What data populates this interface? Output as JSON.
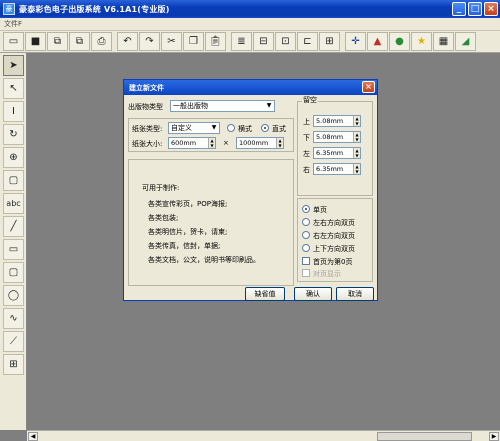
{
  "window": {
    "title": "豪泰彩色电子出版系统 V6.1A1(专业版)"
  },
  "menu": {
    "items": [
      "文件F"
    ]
  },
  "toolbar": {
    "buttons": [
      "new-icon",
      "save-icon",
      "import-icon",
      "export-icon",
      "print-icon",
      "undo-icon",
      "redo-icon",
      "cut-icon",
      "copy-icon",
      "paste-icon",
      "layers-icon",
      "align-icon",
      "group-icon",
      "ungroup-icon",
      "frame-icon",
      "move-cross-icon",
      "color-icon",
      "gradient-icon",
      "star-icon",
      "map-icon",
      "chart-icon"
    ]
  },
  "left_tools": [
    {
      "name": "select-arrow-icon",
      "glyph": "▲"
    },
    {
      "name": "node-arrow-icon",
      "glyph": "↖"
    },
    {
      "name": "text-tool-icon",
      "glyph": "I"
    },
    {
      "name": "rotate-icon",
      "glyph": "↻"
    },
    {
      "name": "zoom-icon",
      "glyph": "⊕"
    },
    {
      "name": "frame-tool-icon",
      "glyph": "▢"
    },
    {
      "name": "abc-text-icon",
      "glyph": "abc"
    },
    {
      "name": "line-tool-icon",
      "glyph": "╱"
    },
    {
      "name": "rectangle-tool-icon",
      "glyph": "▭"
    },
    {
      "name": "rounded-rect-tool-icon",
      "glyph": "▢"
    },
    {
      "name": "ellipse-tool-icon",
      "glyph": "◯"
    },
    {
      "name": "curve-tool-icon",
      "glyph": "∿"
    },
    {
      "name": "polyline-tool-icon",
      "glyph": "⟋"
    },
    {
      "name": "table-tool-icon",
      "glyph": "⊞"
    }
  ],
  "dialog": {
    "title": "建立新文件",
    "pub_type_label": "出版物类型",
    "pub_type_value": "一般出版物",
    "paper_type_label": "纸张类型:",
    "paper_type_value": "自定义",
    "orientation_landscape": "横式",
    "orientation_portrait": "直式",
    "paper_size_label": "纸张大小:",
    "width_value": "600mm",
    "times": "×",
    "height_value": "1000mm",
    "margin_group": "留空",
    "margin_top_label": "上",
    "margin_top": "5.08mm",
    "margin_bottom_label": "下",
    "margin_bottom": "5.08mm",
    "margin_left_label": "左",
    "margin_left": "6.35mm",
    "margin_right_label": "右",
    "margin_right": "6.35mm",
    "usage_title": "可用于制作:",
    "usage_lines": [
      "各类宣传彩页，POP海报;",
      "各类包装;",
      "各类明信片，贺卡，请柬;",
      "各类传真，信封，单据;",
      "各类文档，公文，说明书等印刷品。"
    ],
    "page_opt_single": "单页",
    "page_opt_lr": "左右方向双页",
    "page_opt_rl": "右左方向双页",
    "page_opt_tb": "上下方向双页",
    "first_page_zero": "首页为第0页",
    "show_spread": "对页显示",
    "default_button": "缺省值",
    "ok_button": "确认",
    "cancel_button": "取消"
  }
}
